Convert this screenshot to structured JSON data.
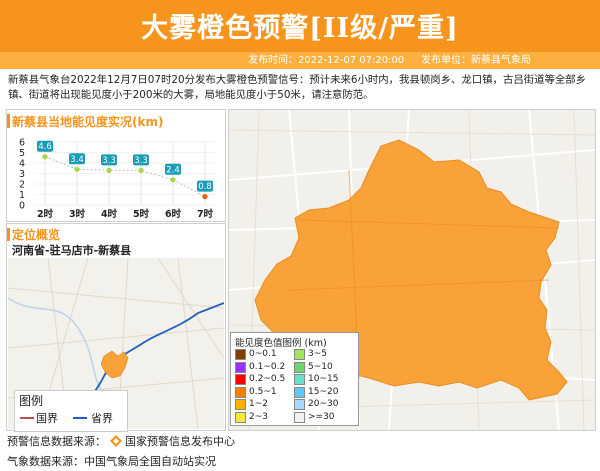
{
  "header": {
    "title": "大雾橙色预警[II级/严重]",
    "publish_time": "发布时间：2022-12-07 07:20:00",
    "publish_unit": "发布单位：新蔡县气象局"
  },
  "description": "新蔡县气象台2022年12月7日07时20分发布大雾橙色预警信号：预计未来6小时内，我县顿岗乡、龙口镇，古吕街道等全部乡镇、街道将出现能见度小于200米的大雾，局地能见度小于50米，请注意防范。",
  "visibility_panel": {
    "title": "新蔡县当地能见度实况(km)"
  },
  "chart_data": {
    "type": "line",
    "title": "新蔡县当地能见度实况(km)",
    "categories": [
      "2时",
      "3时",
      "4时",
      "5时",
      "6时",
      "7时"
    ],
    "values": [
      4.6,
      3.4,
      3.3,
      3.3,
      2.4,
      0.8
    ],
    "labels": [
      "4.6",
      "3.4",
      "3.3",
      "3.3",
      "2.4",
      "0.8"
    ],
    "y_ticks": [
      "0",
      "1",
      "2",
      "3",
      "4",
      "5",
      "6"
    ],
    "ylim": [
      0,
      6
    ],
    "grid": true
  },
  "location_panel": {
    "title": "定位概览",
    "region": "河南省-驻马店市-新蔡县",
    "legend_title": "图例",
    "legend_country": "国界",
    "legend_province": "省界",
    "country_color": "#c0504d",
    "province_color": "#1f5fbf"
  },
  "vis_legend": {
    "title": "能见度色值图例 (km)",
    "items": [
      {
        "label": "0~0.1",
        "color": "#7f3f00"
      },
      {
        "label": "3~5",
        "color": "#9ee65a"
      },
      {
        "label": "0.1~0.2",
        "color": "#9b30ff"
      },
      {
        "label": "5~10",
        "color": "#6cd66c"
      },
      {
        "label": "0.2~0.5",
        "color": "#ff0000"
      },
      {
        "label": "10~15",
        "color": "#66e0c8"
      },
      {
        "label": "0.5~1",
        "color": "#ff7f00"
      },
      {
        "label": "15~20",
        "color": "#5ac8f0"
      },
      {
        "label": "1~2",
        "color": "#ffb000"
      },
      {
        "label": "20~30",
        "color": "#a8d8ff"
      },
      {
        "label": "2~3",
        "color": "#f5e642"
      },
      {
        "label": ">=30",
        "color": "#f2f2f2"
      }
    ]
  },
  "footer": {
    "warning_source": "预警信息数据来源：",
    "warning_source_name": "国家预警信息发布中心",
    "weather_source": "气象数据来源：中国气象局全国自动站实况"
  },
  "colors": {
    "accent": "#f7941d",
    "accent_light": "#fbb040",
    "fog_area": "#f9a23a",
    "point_label_bg": "#1b9bb5",
    "point_low": "#e8620c",
    "point_normal": "#a8d64a"
  }
}
